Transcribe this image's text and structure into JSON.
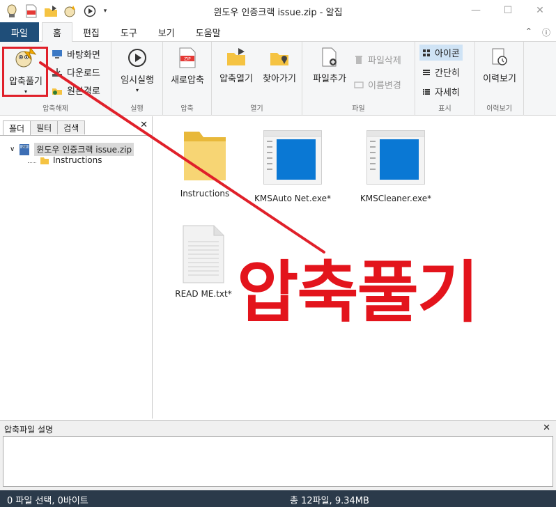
{
  "window": {
    "title": "윈도우 인증크랙 issue.zip - 알집"
  },
  "tabs": {
    "file": "파일",
    "items": [
      "홈",
      "편집",
      "도구",
      "보기",
      "도움말"
    ]
  },
  "ribbon": {
    "extract": {
      "label": "압축풀기",
      "desktop": "바탕화면",
      "downloads": "다운로드",
      "original": "원본경로",
      "group": "압축해제"
    },
    "run": {
      "label": "임시실행",
      "group": "실행"
    },
    "compress": {
      "label": "새로압축",
      "group": "압축"
    },
    "open": {
      "open_archive": "압축열기",
      "browse": "찾아가기",
      "group": "열기"
    },
    "file": {
      "add": "파일추가",
      "delete": "파일삭제",
      "rename": "이름변경",
      "group": "파일"
    },
    "view": {
      "icons": "아이콘",
      "simple": "간단히",
      "details": "자세히",
      "group": "표시"
    },
    "history": {
      "label": "이력보기",
      "group": "이력보기"
    }
  },
  "left_panel": {
    "tabs": [
      "폴더",
      "필터",
      "검색"
    ],
    "tree": {
      "root": "윈도우 인증크랙 issue.zip",
      "child": "Instructions"
    }
  },
  "files": [
    {
      "name": "Instructions",
      "type": "folder"
    },
    {
      "name": "KMSAuto Net.exe*",
      "type": "exe"
    },
    {
      "name": "KMSCleaner.exe*",
      "type": "exe"
    },
    {
      "name": "READ ME.txt*",
      "type": "txt"
    }
  ],
  "overlay": {
    "text": "압축풀기",
    "color": "#e3141c"
  },
  "description": {
    "title": "압축파일 설명"
  },
  "status": {
    "selection": "0 파일 선택,  0바이트",
    "total": "총 12파일,  9.34MB"
  }
}
